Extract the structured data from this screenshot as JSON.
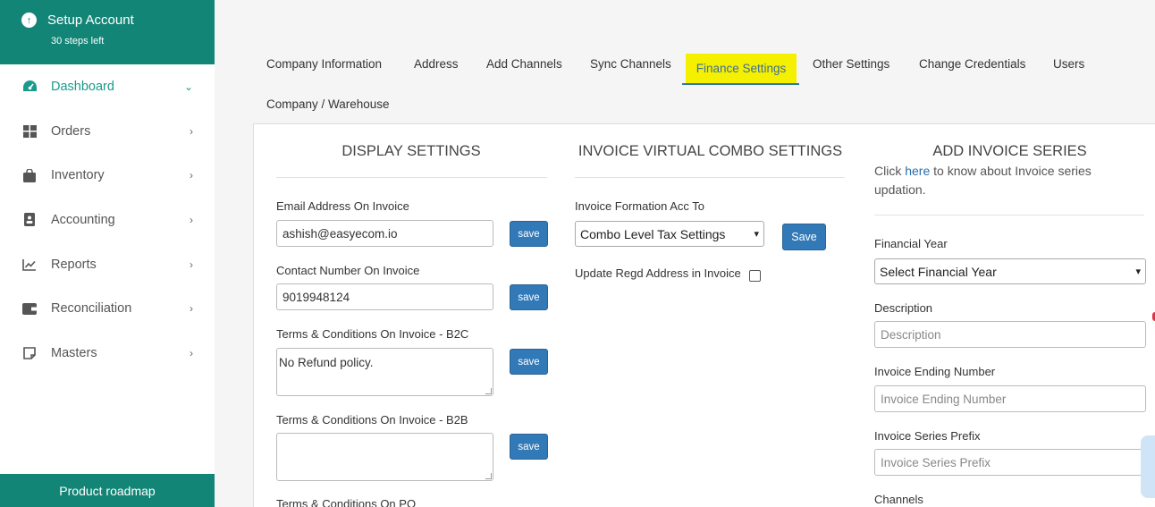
{
  "setup": {
    "title": "Setup Account",
    "steps": "30 steps left"
  },
  "nav": [
    {
      "label": "Dashboard",
      "icon": "dashboard-icon",
      "active": true
    },
    {
      "label": "Orders",
      "icon": "grid-icon"
    },
    {
      "label": "Inventory",
      "icon": "bag-icon"
    },
    {
      "label": "Accounting",
      "icon": "contact-book-icon"
    },
    {
      "label": "Reports",
      "icon": "chart-icon"
    },
    {
      "label": "Reconciliation",
      "icon": "wallet-icon"
    },
    {
      "label": "Masters",
      "icon": "note-icon"
    }
  ],
  "roadmap_label": "Product roadmap",
  "tabs": [
    "Company Information",
    "Address",
    "Add Channels",
    "Sync Channels",
    "Finance Settings",
    "Other Settings",
    "Change Credentials",
    "Users",
    "Company / Warehouse"
  ],
  "active_tab": "Finance Settings",
  "display": {
    "title": "DISPLAY SETTINGS",
    "email_label": "Email Address On Invoice",
    "email_value": "ashish@easyecom.io",
    "contact_label": "Contact Number On Invoice",
    "contact_value": "9019948124",
    "b2c_label": "Terms & Conditions On Invoice - B2C",
    "b2c_value": "No Refund policy.",
    "b2b_label": "Terms & Conditions On Invoice - B2B",
    "b2b_value": "",
    "po_label": "Terms & Conditions On PO",
    "save_label": "save"
  },
  "combo": {
    "title": "INVOICE VIRTUAL COMBO SETTINGS",
    "formation_label": "Invoice Formation Acc To",
    "formation_value": "Combo Level Tax Settings",
    "save_label": "Save",
    "regd_label": "Update Regd Address in Invoice"
  },
  "series": {
    "title": "ADD INVOICE SERIES",
    "click_text": "Click ",
    "here_text": "here",
    "after_text": " to know about Invoice series",
    "after_text2": "updation.",
    "fy_label": "Financial Year",
    "fy_value": "Select Financial Year",
    "desc_label": "Description",
    "desc_placeholder": "Description",
    "ending_label": "Invoice Ending Number",
    "ending_placeholder": "Invoice Ending Number",
    "prefix_label": "Invoice Series Prefix",
    "prefix_placeholder": "Invoice Series Prefix",
    "channels_label": "Channels"
  },
  "colors": {
    "brand": "#138577",
    "accent": "#1a9a8b",
    "button": "#3279b7",
    "highlight": "#f5f000"
  }
}
